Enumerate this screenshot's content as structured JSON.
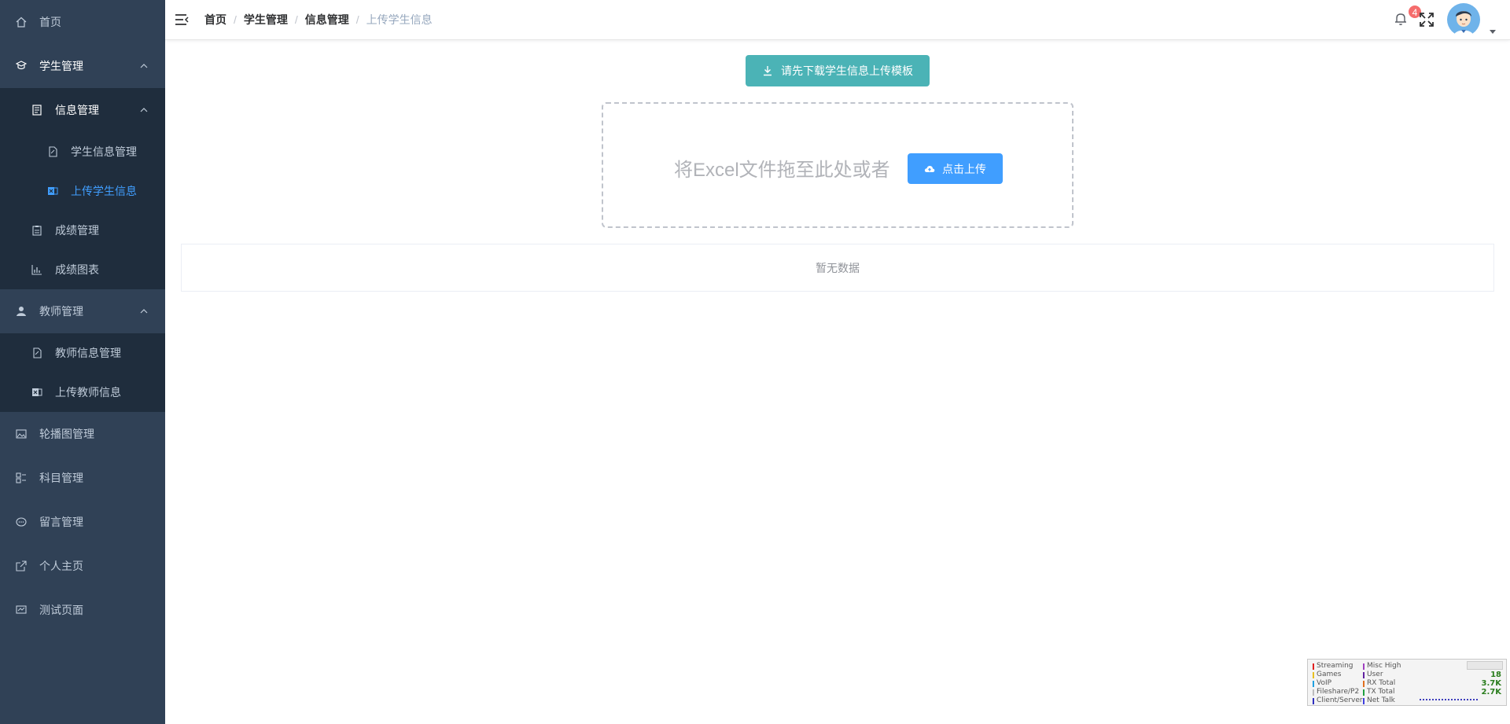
{
  "sidebar": {
    "home": "首页",
    "student_mgmt": "学生管理",
    "info_mgmt": "信息管理",
    "student_info_mgmt": "学生信息管理",
    "upload_student_info": "上传学生信息",
    "score_mgmt": "成绩管理",
    "score_chart": "成绩图表",
    "teacher_mgmt": "教师管理",
    "teacher_info_mgmt": "教师信息管理",
    "upload_teacher_info": "上传教师信息",
    "carousel_mgmt": "轮播图管理",
    "subject_mgmt": "科目管理",
    "message_mgmt": "留言管理",
    "personal_home": "个人主页",
    "test_page": "测试页面"
  },
  "breadcrumb": {
    "home": "首页",
    "student_mgmt": "学生管理",
    "info_mgmt": "信息管理",
    "current": "上传学生信息",
    "separator": "/"
  },
  "header": {
    "notification_count": "4"
  },
  "main": {
    "download_template_label": "请先下载学生信息上传模板",
    "drop_text": "将Excel文件拖至此处或者",
    "upload_button_label": "点击上传",
    "empty_text": "暂无数据"
  },
  "net_widget": {
    "left_labels": [
      "Streaming",
      "Games",
      "VoIP",
      "Fileshare/P2",
      "Client/Server"
    ],
    "right_labels": [
      "Misc High",
      "User",
      "RX Total",
      "TX Total",
      "Net Talk"
    ],
    "values": [
      "18",
      "3.7K",
      "2.7K"
    ]
  },
  "colors": {
    "sidebar_bg": "#304156",
    "submenu_bg": "#1f2d3d",
    "active": "#409eff",
    "template_button": "#4bb3b6",
    "badge": "#f56c6c"
  }
}
